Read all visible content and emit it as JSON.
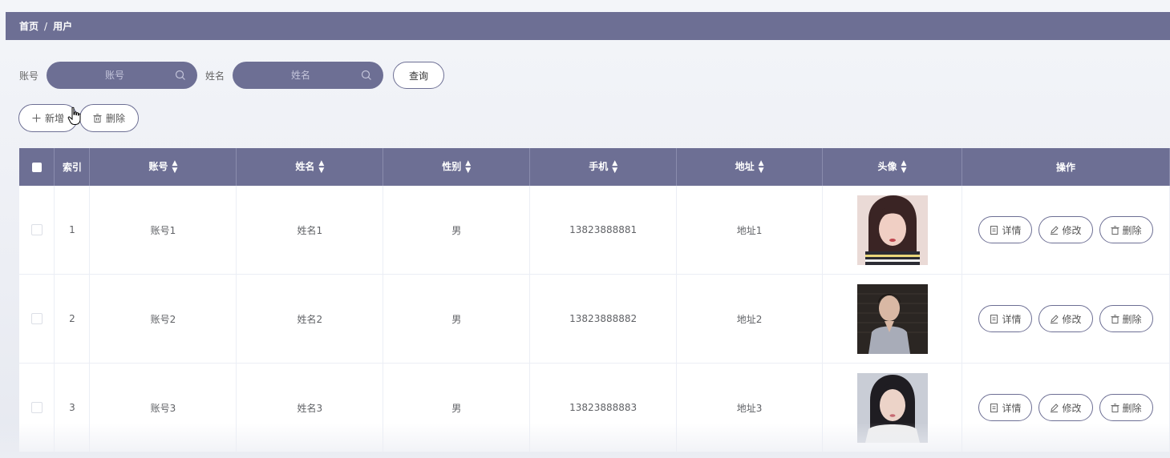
{
  "breadcrumb": {
    "home": "首页",
    "separator": "/",
    "current": "用户"
  },
  "search": {
    "account_label": "账号",
    "account_placeholder": "账号",
    "name_label": "姓名",
    "name_placeholder": "姓名",
    "query_button": "查询"
  },
  "actions": {
    "add_label": "新增",
    "delete_label": "删除"
  },
  "table": {
    "headers": {
      "index": "索引",
      "account": "账号",
      "name": "姓名",
      "gender": "性别",
      "phone": "手机",
      "address": "地址",
      "avatar": "头像",
      "operation": "操作"
    },
    "rows": [
      {
        "index": "1",
        "account": "账号1",
        "name": "姓名1",
        "gender": "男",
        "phone": "13823888881",
        "address": "地址1"
      },
      {
        "index": "2",
        "account": "账号2",
        "name": "姓名2",
        "gender": "男",
        "phone": "13823888882",
        "address": "地址2"
      },
      {
        "index": "3",
        "account": "账号3",
        "name": "姓名3",
        "gender": "男",
        "phone": "13823888883",
        "address": "地址3"
      }
    ],
    "row_actions": {
      "detail": "详情",
      "edit": "修改",
      "delete": "删除"
    }
  },
  "colors": {
    "primary": "#6d6f94",
    "background": "#eceef4",
    "text": "#606266"
  }
}
